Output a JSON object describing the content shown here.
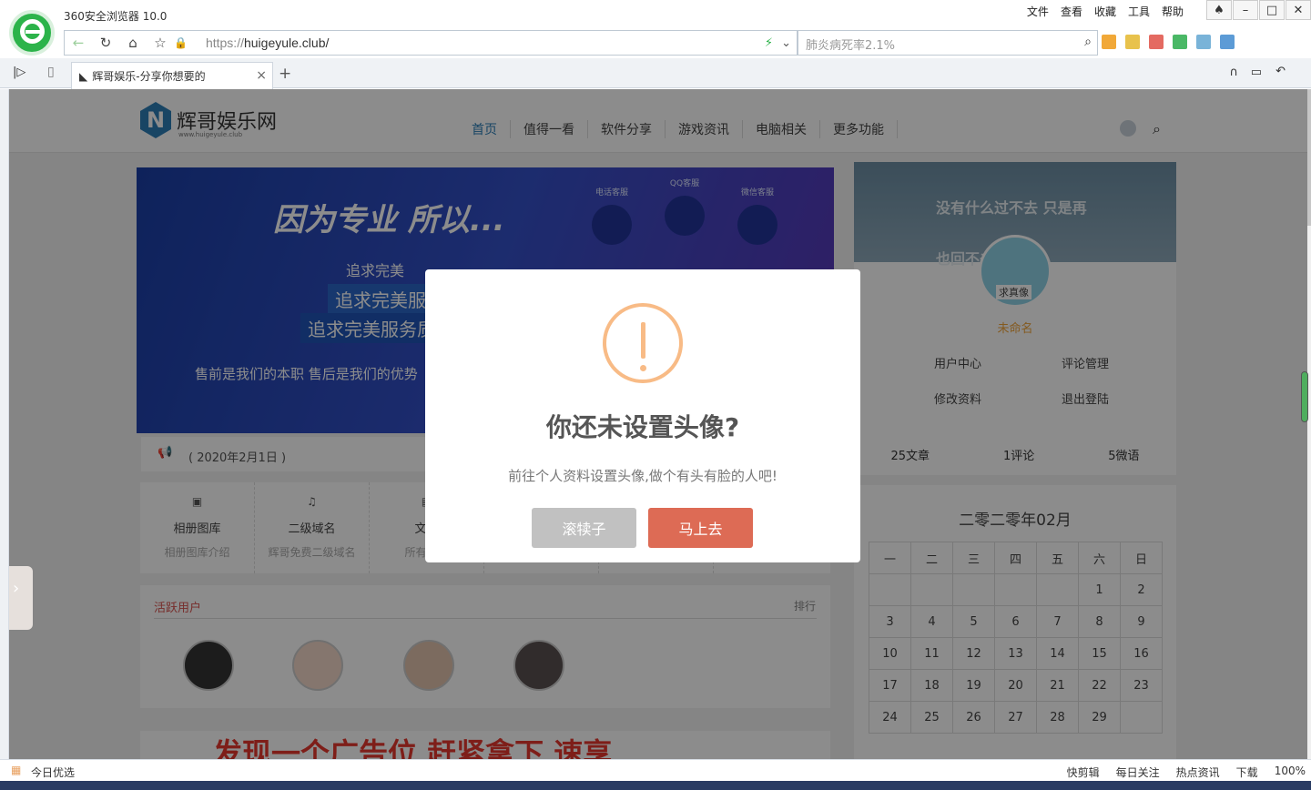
{
  "browser": {
    "title": "360安全浏览器 10.0",
    "menu": [
      "文件",
      "查看",
      "收藏",
      "工具",
      "帮助"
    ],
    "url_scheme": "https://",
    "url_host": "huigeyule.club/",
    "search_placeholder": "肺炎病死率2.1%",
    "tab_title": "辉哥娱乐-分享你想要的",
    "new_tab": "+",
    "tab_close": "×",
    "status_left": "今日优选",
    "status_items": [
      "快剪辑",
      "每日关注",
      "热点资讯",
      "下载",
      "100%"
    ]
  },
  "site": {
    "logo_text": "辉哥娱乐网",
    "logo_sub": "www.huigeyule.club",
    "nav": [
      "首页",
      "值得一看",
      "软件分享",
      "游戏资讯",
      "电脑相关",
      "更多功能"
    ],
    "banner": {
      "headline": "因为专业 所以...",
      "line1": "追求完美",
      "line2": "追求完美服务",
      "line3": "追求完美服务质",
      "footer": "售前是我们的本职   售后是我们的优势",
      "icons": [
        "电话客服",
        "QQ客服",
        "微信客服"
      ]
    },
    "notice_date": "( 2020年2月1日 )",
    "quick_links": [
      {
        "title": "相册图库",
        "sub": "相册图库介绍"
      },
      {
        "title": "二级域名",
        "sub": "辉哥免费二级域名"
      },
      {
        "title": "文章",
        "sub": "所有文章"
      }
    ],
    "active_users_title": "活跃用户",
    "active_users_rank": "排行",
    "ad_text": "发现一个广告位 赶紧拿下 速享"
  },
  "profile": {
    "cover_text": "没有什么过不去 只是再也回不去",
    "avatar_label": "求真像",
    "name": "未命名",
    "links": [
      "用户中心",
      "评论管理",
      "修改资料",
      "退出登陆"
    ],
    "stats": [
      "25文章",
      "1评论",
      "5微语"
    ]
  },
  "calendar": {
    "title": "二零二零年02月",
    "weekdays": [
      "一",
      "二",
      "三",
      "四",
      "五",
      "六",
      "日"
    ],
    "weeks": [
      [
        "",
        "",
        "",
        "",
        "",
        "1",
        "2"
      ],
      [
        "3",
        "4",
        "5",
        "6",
        "7",
        "8",
        "9"
      ],
      [
        "10",
        "11",
        "12",
        "13",
        "14",
        "15",
        "16"
      ],
      [
        "17",
        "18",
        "19",
        "20",
        "21",
        "22",
        "23"
      ],
      [
        "24",
        "25",
        "26",
        "27",
        "28",
        "29",
        ""
      ]
    ]
  },
  "dialog": {
    "title": "你还未设置头像?",
    "text": "前往个人资料设置头像,做个有头有脸的人吧!",
    "cancel": "滚犊子",
    "confirm": "马上去"
  }
}
